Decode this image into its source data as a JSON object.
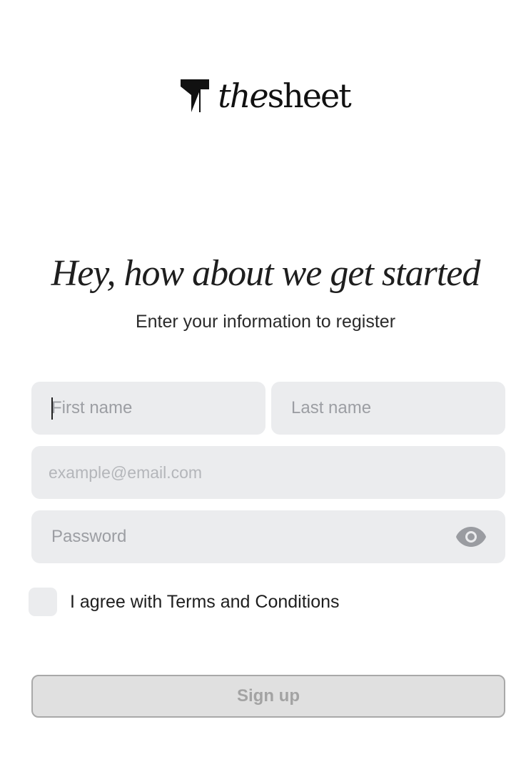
{
  "brand": {
    "name_italic": "the",
    "name_regular": "sheet",
    "logo_icon": "thesheet-logo-mark"
  },
  "header": {
    "title": "Hey, how about we get started",
    "subtitle": "Enter your information to register"
  },
  "form": {
    "first_name": {
      "placeholder": "First name",
      "value": ""
    },
    "last_name": {
      "placeholder": "Last name",
      "value": ""
    },
    "email": {
      "placeholder": "example@email.com",
      "value": ""
    },
    "password": {
      "placeholder": "Password",
      "value": "",
      "toggle_icon": "eye-icon"
    },
    "terms": {
      "label": "I agree with Terms and Conditions",
      "checked": false
    },
    "submit_label": "Sign up"
  },
  "colors": {
    "field_background": "#ebecee",
    "button_background": "#e0e0e0",
    "button_text": "#a3a3a3",
    "text": "#1e1e1e"
  }
}
